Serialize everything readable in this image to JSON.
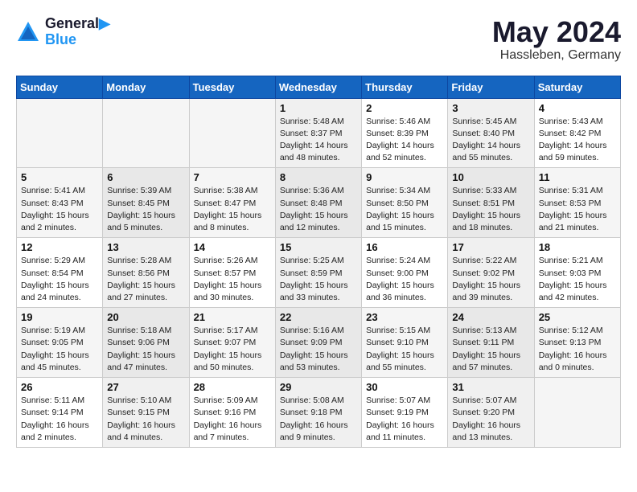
{
  "header": {
    "logo_line1": "General",
    "logo_line2": "Blue",
    "month": "May 2024",
    "location": "Hassleben, Germany"
  },
  "weekdays": [
    "Sunday",
    "Monday",
    "Tuesday",
    "Wednesday",
    "Thursday",
    "Friday",
    "Saturday"
  ],
  "weeks": [
    [
      {
        "day": "",
        "info": ""
      },
      {
        "day": "",
        "info": ""
      },
      {
        "day": "",
        "info": ""
      },
      {
        "day": "1",
        "info": "Sunrise: 5:48 AM\nSunset: 8:37 PM\nDaylight: 14 hours\nand 48 minutes."
      },
      {
        "day": "2",
        "info": "Sunrise: 5:46 AM\nSunset: 8:39 PM\nDaylight: 14 hours\nand 52 minutes."
      },
      {
        "day": "3",
        "info": "Sunrise: 5:45 AM\nSunset: 8:40 PM\nDaylight: 14 hours\nand 55 minutes."
      },
      {
        "day": "4",
        "info": "Sunrise: 5:43 AM\nSunset: 8:42 PM\nDaylight: 14 hours\nand 59 minutes."
      }
    ],
    [
      {
        "day": "5",
        "info": "Sunrise: 5:41 AM\nSunset: 8:43 PM\nDaylight: 15 hours\nand 2 minutes."
      },
      {
        "day": "6",
        "info": "Sunrise: 5:39 AM\nSunset: 8:45 PM\nDaylight: 15 hours\nand 5 minutes."
      },
      {
        "day": "7",
        "info": "Sunrise: 5:38 AM\nSunset: 8:47 PM\nDaylight: 15 hours\nand 8 minutes."
      },
      {
        "day": "8",
        "info": "Sunrise: 5:36 AM\nSunset: 8:48 PM\nDaylight: 15 hours\nand 12 minutes."
      },
      {
        "day": "9",
        "info": "Sunrise: 5:34 AM\nSunset: 8:50 PM\nDaylight: 15 hours\nand 15 minutes."
      },
      {
        "day": "10",
        "info": "Sunrise: 5:33 AM\nSunset: 8:51 PM\nDaylight: 15 hours\nand 18 minutes."
      },
      {
        "day": "11",
        "info": "Sunrise: 5:31 AM\nSunset: 8:53 PM\nDaylight: 15 hours\nand 21 minutes."
      }
    ],
    [
      {
        "day": "12",
        "info": "Sunrise: 5:29 AM\nSunset: 8:54 PM\nDaylight: 15 hours\nand 24 minutes."
      },
      {
        "day": "13",
        "info": "Sunrise: 5:28 AM\nSunset: 8:56 PM\nDaylight: 15 hours\nand 27 minutes."
      },
      {
        "day": "14",
        "info": "Sunrise: 5:26 AM\nSunset: 8:57 PM\nDaylight: 15 hours\nand 30 minutes."
      },
      {
        "day": "15",
        "info": "Sunrise: 5:25 AM\nSunset: 8:59 PM\nDaylight: 15 hours\nand 33 minutes."
      },
      {
        "day": "16",
        "info": "Sunrise: 5:24 AM\nSunset: 9:00 PM\nDaylight: 15 hours\nand 36 minutes."
      },
      {
        "day": "17",
        "info": "Sunrise: 5:22 AM\nSunset: 9:02 PM\nDaylight: 15 hours\nand 39 minutes."
      },
      {
        "day": "18",
        "info": "Sunrise: 5:21 AM\nSunset: 9:03 PM\nDaylight: 15 hours\nand 42 minutes."
      }
    ],
    [
      {
        "day": "19",
        "info": "Sunrise: 5:19 AM\nSunset: 9:05 PM\nDaylight: 15 hours\nand 45 minutes."
      },
      {
        "day": "20",
        "info": "Sunrise: 5:18 AM\nSunset: 9:06 PM\nDaylight: 15 hours\nand 47 minutes."
      },
      {
        "day": "21",
        "info": "Sunrise: 5:17 AM\nSunset: 9:07 PM\nDaylight: 15 hours\nand 50 minutes."
      },
      {
        "day": "22",
        "info": "Sunrise: 5:16 AM\nSunset: 9:09 PM\nDaylight: 15 hours\nand 53 minutes."
      },
      {
        "day": "23",
        "info": "Sunrise: 5:15 AM\nSunset: 9:10 PM\nDaylight: 15 hours\nand 55 minutes."
      },
      {
        "day": "24",
        "info": "Sunrise: 5:13 AM\nSunset: 9:11 PM\nDaylight: 15 hours\nand 57 minutes."
      },
      {
        "day": "25",
        "info": "Sunrise: 5:12 AM\nSunset: 9:13 PM\nDaylight: 16 hours\nand 0 minutes."
      }
    ],
    [
      {
        "day": "26",
        "info": "Sunrise: 5:11 AM\nSunset: 9:14 PM\nDaylight: 16 hours\nand 2 minutes."
      },
      {
        "day": "27",
        "info": "Sunrise: 5:10 AM\nSunset: 9:15 PM\nDaylight: 16 hours\nand 4 minutes."
      },
      {
        "day": "28",
        "info": "Sunrise: 5:09 AM\nSunset: 9:16 PM\nDaylight: 16 hours\nand 7 minutes."
      },
      {
        "day": "29",
        "info": "Sunrise: 5:08 AM\nSunset: 9:18 PM\nDaylight: 16 hours\nand 9 minutes."
      },
      {
        "day": "30",
        "info": "Sunrise: 5:07 AM\nSunset: 9:19 PM\nDaylight: 16 hours\nand 11 minutes."
      },
      {
        "day": "31",
        "info": "Sunrise: 5:07 AM\nSunset: 9:20 PM\nDaylight: 16 hours\nand 13 minutes."
      },
      {
        "day": "",
        "info": ""
      }
    ]
  ]
}
